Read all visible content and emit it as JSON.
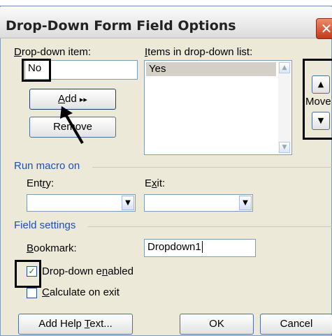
{
  "window": {
    "title": "Drop-Down Form Field Options",
    "close_symbol": "✕"
  },
  "dropdown_item": {
    "label_accel": "D",
    "label_rest": "rop-down item:",
    "value": "No"
  },
  "buttons": {
    "add_accel": "A",
    "add_rest": "dd",
    "add_arrows": "▸▸",
    "remove_label": "Remove"
  },
  "items_list": {
    "label_accel": "I",
    "label_rest": "tems in drop-down list:",
    "items": [
      "Yes"
    ],
    "selected_index": 0
  },
  "move": {
    "label": "Move",
    "up_symbol": "▲",
    "down_symbol": "▼"
  },
  "run_macro": {
    "section_label": "Run macro on",
    "entry_pre": "Ent",
    "entry_accel": "r",
    "entry_post": "y:",
    "exit_pre": "E",
    "exit_accel": "x",
    "exit_post": "it:",
    "entry_value": "",
    "exit_value": "",
    "arrow": "▼"
  },
  "field_settings": {
    "section_label": "Field settings",
    "bookmark_accel": "B",
    "bookmark_rest": "ookmark:",
    "bookmark_value": "Dropdown1",
    "dropdown_enabled_accel_pre": "Drop-down e",
    "dropdown_enabled_accel": "n",
    "dropdown_enabled_post": "abled",
    "dropdown_enabled_checked": true,
    "calculate_accel": "C",
    "calculate_rest": "alculate on exit",
    "calculate_checked": false,
    "check_mark": "✓"
  },
  "footer": {
    "help_pre": "Add Help ",
    "help_accel": "T",
    "help_post": "ext...",
    "ok_label": "OK",
    "cancel_label": "Cancel"
  }
}
